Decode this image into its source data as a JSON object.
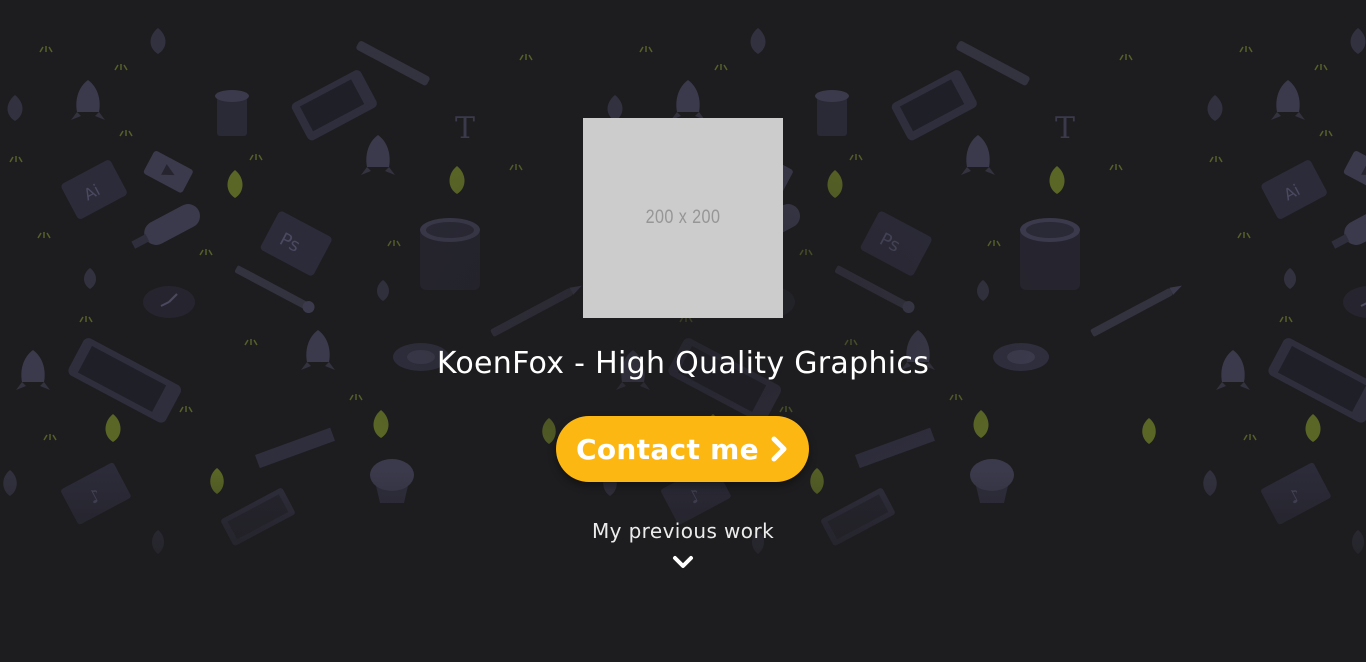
{
  "hero": {
    "logo_placeholder": "200 x 200",
    "title": "KoenFox - High Quality Graphics",
    "cta_label": "Contact me",
    "cta_icon": "chevron-right-icon",
    "previous_work_label": "My previous work",
    "previous_work_icon": "chevron-down-icon"
  },
  "colors": {
    "background": "#1d1d1f",
    "accent": "#fcb712",
    "pattern": "#3b3a4c",
    "leaf": "#6b7a2e",
    "text": "#ffffff"
  }
}
